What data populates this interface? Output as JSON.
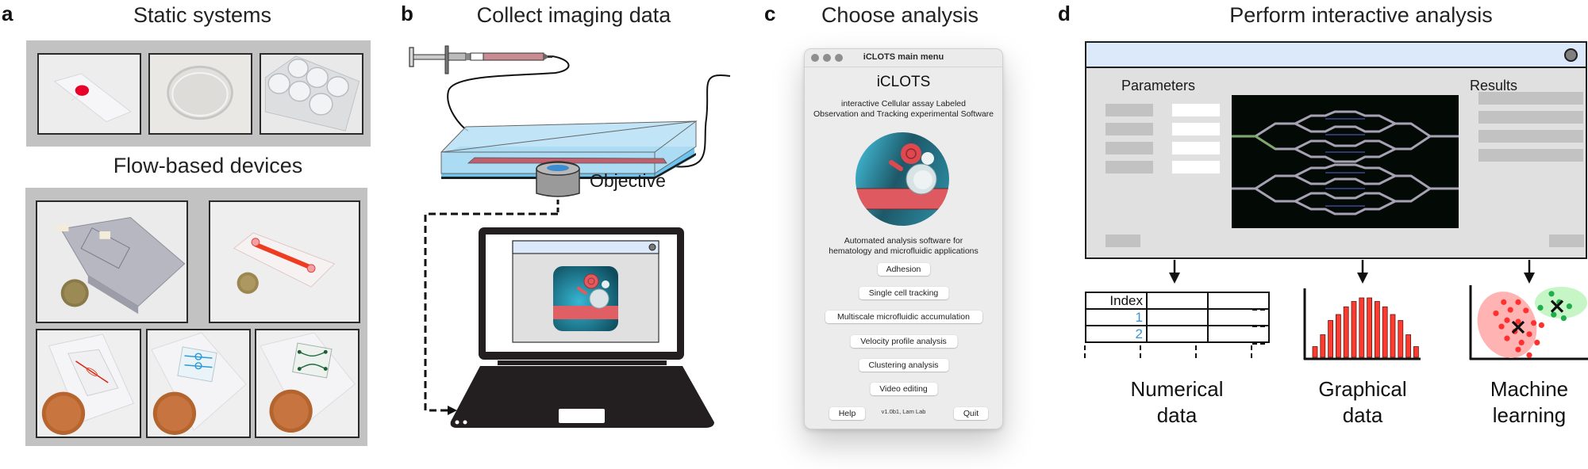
{
  "panel_a": {
    "letter": "a",
    "static_title": "Static systems",
    "static_items": [
      {
        "name": "glass-slide-with-blood-drop"
      },
      {
        "name": "petri-dish"
      },
      {
        "name": "six-well-plate"
      }
    ],
    "flow_title": "Flow-based devices",
    "flow_items": [
      {
        "name": "acrylic-flow-chamber-with-penny"
      },
      {
        "name": "channel-slide-with-penny"
      },
      {
        "name": "microfluidic-red-channel-with-penny"
      },
      {
        "name": "microfluidic-blue-channel-with-penny"
      },
      {
        "name": "microfluidic-green-network-with-penny"
      }
    ]
  },
  "panel_b": {
    "letter": "b",
    "title": "Collect imaging data",
    "objective_label": "Objective",
    "colors": {
      "device_blue": "#b6e0f5",
      "device_base": "#6cc4f0",
      "channel_red": "#c0606e",
      "laptop": "#231f20",
      "screen_window_title": "#dce9fb",
      "screen_window_body": "#e0e0e0"
    }
  },
  "panel_c": {
    "letter": "c",
    "title": "Choose analysis",
    "window": {
      "title": "iCLOTS main menu",
      "app_name": "iCLOTS",
      "subtitle_line1": "interactive Cellular assay Labeled",
      "subtitle_line2": "Observation and Tracking experimental Software",
      "description_line1": "Automated analysis software for",
      "description_line2": "hematology and microfluidic applications",
      "buttons": [
        {
          "label": "Adhesion"
        },
        {
          "label": "Single cell tracking"
        },
        {
          "label": "Multiscale microfluidic accumulation"
        },
        {
          "label": "Velocity profile analysis"
        },
        {
          "label": "Clustering analysis"
        },
        {
          "label": "Video editing"
        }
      ],
      "help_label": "Help",
      "quit_label": "Quit",
      "version": "v1.0b1, Lam Lab"
    },
    "logo_colors": {
      "teal": "#2a7f92",
      "red": "#e05a60",
      "white": "#e8eef0"
    }
  },
  "panel_d": {
    "letter": "d",
    "title": "Perform interactive analysis",
    "window": {
      "parameters_label": "Parameters",
      "results_label": "Results",
      "parameter_rows": 4,
      "result_rows": 4
    },
    "table": {
      "header": "Index",
      "rows": [
        "1",
        "2"
      ]
    },
    "outputs": [
      {
        "line1": "Numerical",
        "line2": "data"
      },
      {
        "line1": "Graphical",
        "line2": "data"
      },
      {
        "line1": "Machine",
        "line2": "learning"
      }
    ],
    "histogram": {
      "type": "bar",
      "values": [
        0.18,
        0.38,
        0.62,
        0.72,
        0.85,
        0.94,
        1.0,
        1.0,
        0.94,
        0.85,
        0.72,
        0.62,
        0.38,
        0.18
      ],
      "color": "#ff3b2f"
    },
    "clusters": [
      {
        "name": "red-cluster",
        "color": "#ff3030",
        "fill": "#ffb3b3",
        "points": [
          [
            0.27,
            0.22
          ],
          [
            0.4,
            0.22
          ],
          [
            0.2,
            0.38
          ],
          [
            0.33,
            0.33
          ],
          [
            0.47,
            0.34
          ],
          [
            0.3,
            0.48
          ],
          [
            0.4,
            0.5
          ],
          [
            0.25,
            0.57
          ],
          [
            0.37,
            0.64
          ],
          [
            0.54,
            0.52
          ],
          [
            0.61,
            0.55
          ],
          [
            0.5,
            0.68
          ],
          [
            0.3,
            0.74
          ],
          [
            0.43,
            0.8
          ],
          [
            0.57,
            0.8
          ],
          [
            0.4,
            0.9
          ],
          [
            0.5,
            0.98
          ]
        ],
        "center": [
          0.4,
          0.58
        ]
      },
      {
        "name": "green-cluster",
        "color": "#1fae4b",
        "fill": "#c6f5c6",
        "points": [
          [
            0.7,
            0.1
          ],
          [
            0.6,
            0.3
          ],
          [
            0.77,
            0.22
          ],
          [
            0.86,
            0.28
          ],
          [
            0.72,
            0.4
          ],
          [
            0.81,
            0.45
          ]
        ],
        "center": [
          0.75,
          0.28
        ]
      }
    ]
  }
}
